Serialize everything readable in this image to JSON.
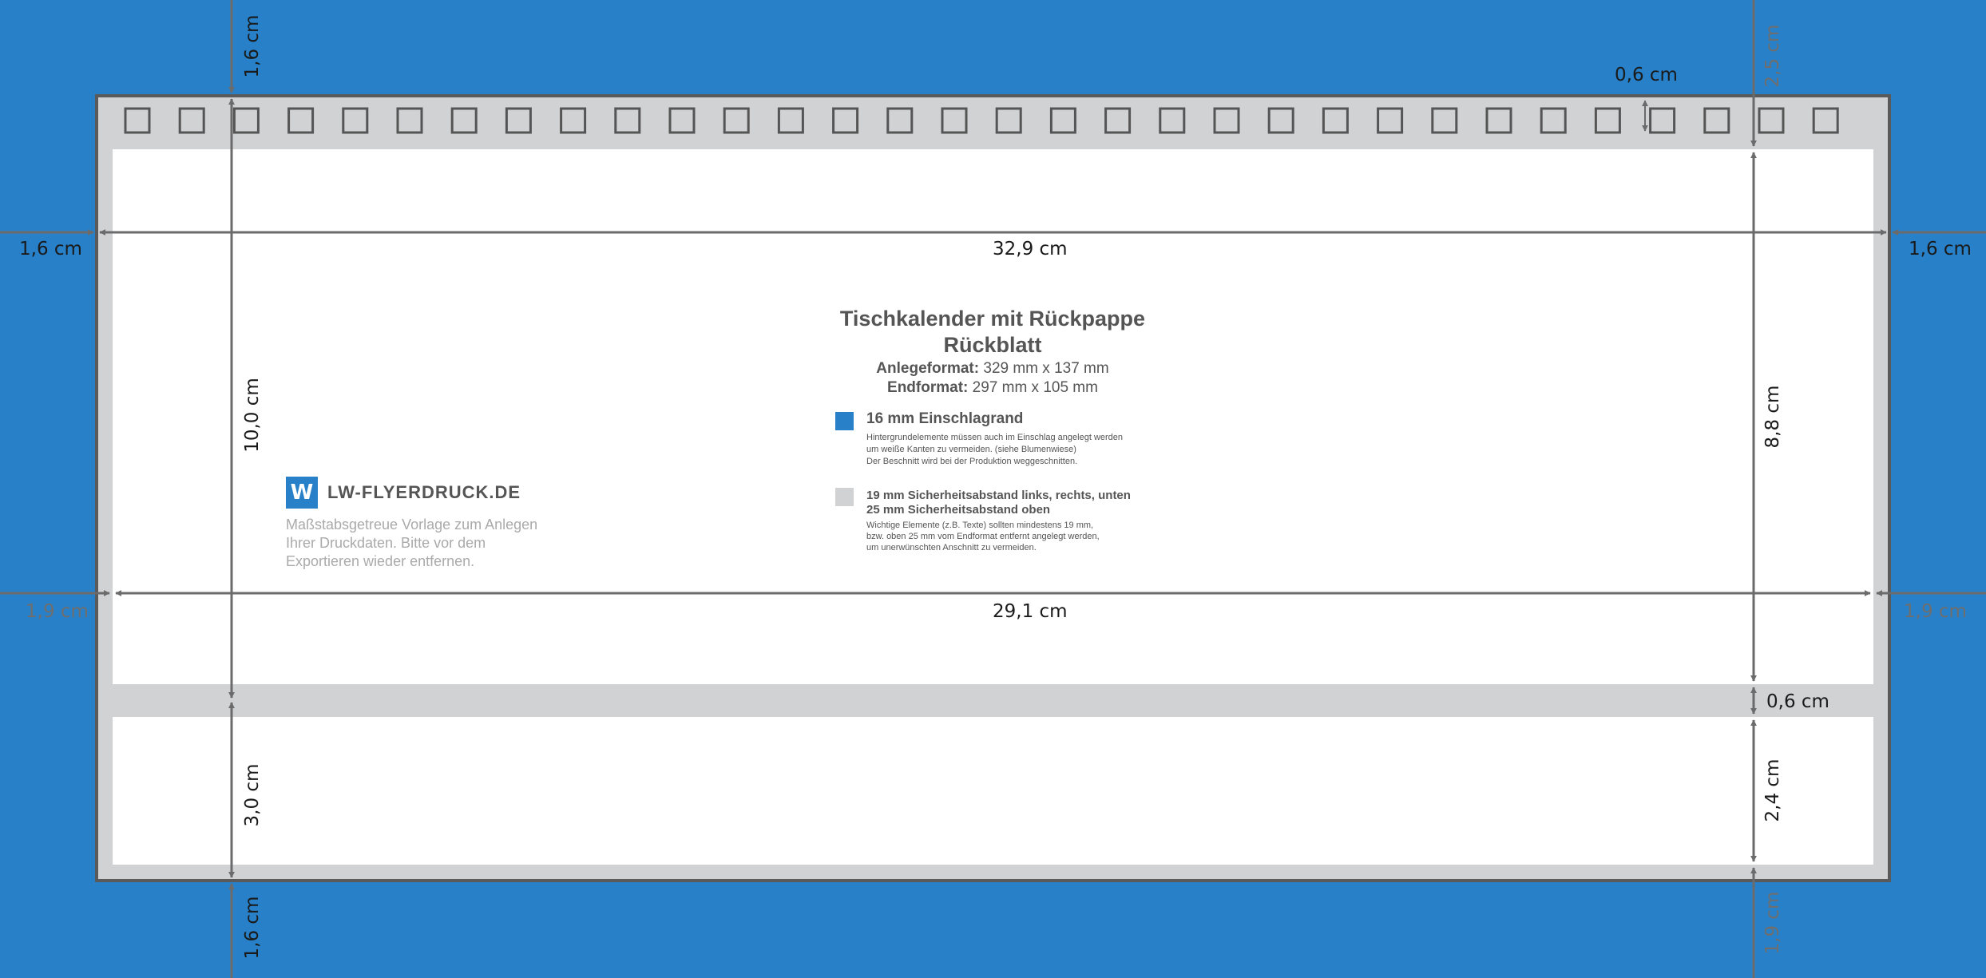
{
  "info": {
    "title_line1": "Tischkalender mit Rückpappe",
    "title_line2": "Rückblatt",
    "anlege_label": "Anlegeformat:",
    "anlege_value": "329 mm x 137 mm",
    "end_label": "Endformat:",
    "end_value": "297 mm x 105 mm"
  },
  "legend": {
    "blue": {
      "color": "#2780c8",
      "title": "16 mm Einschlagrand",
      "lines": [
        "Hintergrundelemente müssen auch im Einschlag angelegt werden",
        "um weiße Kanten zu vermeiden. (siehe Blumenwiese)",
        "Der Beschnitt wird bei der Produktion weggeschnitten."
      ]
    },
    "grey": {
      "color": "#d1d2d4",
      "title_line1": "19 mm Sicherheitsabstand links, rechts, unten",
      "title_line2": "25 mm Sicherheitsabstand oben",
      "lines": [
        "Wichtige Elemente (z.B. Texte) sollten mindestens 19 mm,",
        "bzw. oben 25 mm vom Endformat entfernt angelegt werden,",
        "um unerwünschten Anschnitt zu vermeiden."
      ]
    }
  },
  "brand": {
    "logo_text": "W",
    "name": "LW-FLYERDRUCK.DE",
    "note": "Maßstabsgetreue Vorlage zum Anlegen Ihrer Druckdaten. Bitte vor dem Exportieren wieder entfernen."
  },
  "dimensions": {
    "top_left_vertical": "1,6 cm",
    "top_right_vertical": "2,5 cm",
    "hole_height": "0,6 cm",
    "left_outer": "1,6 cm",
    "right_outer": "1,6 cm",
    "total_width": "32,9 cm",
    "inner_width": "29,1 cm",
    "left_inner_margin": "1,9 cm",
    "right_inner_margin": "1,9 cm",
    "main_height": "10,0 cm",
    "upper_panel_height": "8,8 cm",
    "fold_gap": "0,6 cm",
    "bottom_panel_height": "2,4 cm",
    "base_height": "3,0 cm",
    "bottom_left_vertical": "1,6 cm",
    "bottom_right_vertical": "1,9 cm"
  },
  "binding": {
    "hole_count": 32
  },
  "colors": {
    "background": "#2780c8",
    "bleed_frame": "#d1d2d4",
    "safe_area": "#ffffff",
    "dimension_line": "#6b6b6b"
  }
}
